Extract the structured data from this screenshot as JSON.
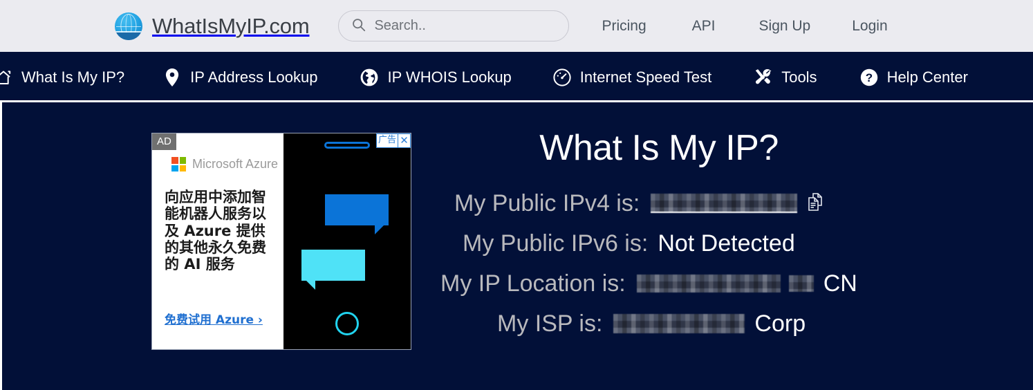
{
  "header": {
    "brand_name": "WhatIsMyIP.com",
    "logo_icon": "globe-logo-icon",
    "search": {
      "placeholder": "Search..",
      "value": "",
      "icon": "search-icon"
    },
    "links": [
      {
        "label": "Pricing"
      },
      {
        "label": "API"
      },
      {
        "label": "Sign Up"
      },
      {
        "label": "Login"
      }
    ]
  },
  "nav": {
    "items": [
      {
        "label": "What Is My IP?",
        "icon": "home-icon"
      },
      {
        "label": "IP Address Lookup",
        "icon": "map-pin-icon"
      },
      {
        "label": "IP WHOIS Lookup",
        "icon": "globe-icon"
      },
      {
        "label": "Internet Speed Test",
        "icon": "speedometer-icon"
      },
      {
        "label": "Tools",
        "icon": "tools-icon"
      },
      {
        "label": "Help Center",
        "icon": "question-circle-icon"
      }
    ]
  },
  "ad": {
    "badge": "AD",
    "advertiser": "Microsoft Azure",
    "headline": "向应用中添加智能机器人服务以及 Azure 提供的其他永久免费的 AI 服务",
    "cta": "免费试用 Azure ›",
    "close_label": "广告",
    "close_icon": "close-icon",
    "creative_icon": "phone-chat-illustration"
  },
  "main": {
    "title": "What Is My IP?",
    "rows": [
      {
        "label": "My Public IPv4 is:",
        "value": "",
        "redacted": true,
        "copy_icon": "copy-icon"
      },
      {
        "label": "My Public IPv6 is:",
        "value": "Not Detected",
        "redacted": false
      },
      {
        "label": "My IP Location is:",
        "value": "CN",
        "redacted": true
      },
      {
        "label": "My ISP is:",
        "value": "Corp",
        "redacted": true
      }
    ]
  },
  "colors": {
    "topbar_bg": "#ebebf0",
    "nav_bg": "#021038",
    "page_bg": "#021038",
    "accent_blue": "#0b74d8",
    "cyan": "#4fe2f7",
    "label_gray": "#b9b9bd"
  }
}
